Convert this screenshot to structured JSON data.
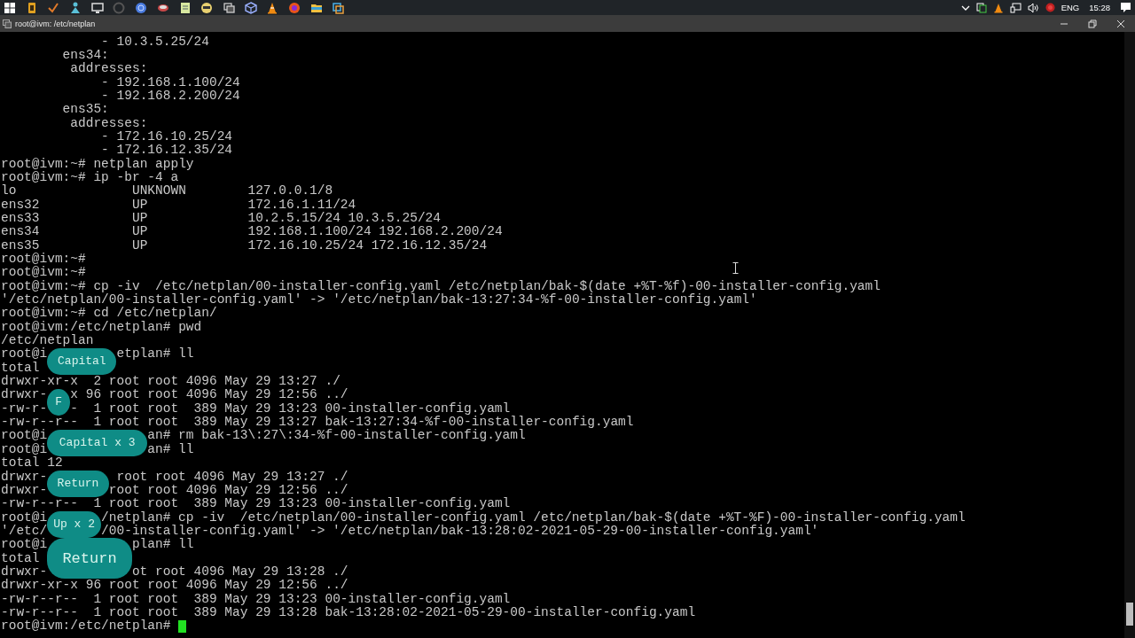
{
  "taskbar": {
    "language": "ENG",
    "clock": "15:28"
  },
  "window": {
    "title": "root@ivm: /etc/netplan"
  },
  "terminal": {
    "lines": [
      "             - 10.3.5.25/24",
      "        ens34:",
      "         addresses:",
      "             - 192.168.1.100/24",
      "             - 192.168.2.200/24",
      "        ens35:",
      "         addresses:",
      "             - 172.16.10.25/24",
      "             - 172.16.12.35/24",
      "root@ivm:~# netplan apply",
      "root@ivm:~# ip -br -4 a",
      "lo               UNKNOWN        127.0.0.1/8",
      "ens32            UP             172.16.1.11/24",
      "ens33            UP             10.2.5.15/24 10.3.5.25/24",
      "ens34            UP             192.168.1.100/24 192.168.2.200/24",
      "ens35            UP             172.16.10.25/24 172.16.12.35/24",
      "root@ivm:~#",
      "root@ivm:~#",
      "root@ivm:~# cp -iv  /etc/netplan/00-installer-config.yaml /etc/netplan/bak-$(date +%T-%f)-00-installer-config.yaml",
      "'/etc/netplan/00-installer-config.yaml' -> '/etc/netplan/bak-13:27:34-%f-00-installer-config.yaml'",
      "root@ivm:~# cd /etc/netplan/",
      "root@ivm:/etc/netplan# pwd",
      "/etc/netplan",
      [
        "root@i",
        "etplan# ll"
      ],
      "total",
      "drwxr-xr-x  2 root root 4096 May 29 13:27 ./",
      [
        "drwxr-",
        "x 96 root root 4096 May 29 12:56 ../"
      ],
      [
        "-rw-r-",
        "-  1 root root  389 May 29 13:23 00-installer-config.yaml"
      ],
      "-rw-r--r--  1 root root  389 May 29 13:27 bak-13:27:34-%f-00-installer-config.yaml",
      [
        "root@i",
        "an# rm bak-13\\:27\\:34-%f-00-installer-config.yaml"
      ],
      [
        "root@i",
        "an# ll"
      ],
      "total 12",
      [
        "drwxr-",
        " root root 4096 May 29 13:27 ./"
      ],
      [
        "drwxr-",
        "root root 4096 May 29 12:56 ../"
      ],
      "-rw-r--r--  1 root root  389 May 29 13:23 00-installer-config.yaml",
      [
        "root@i",
        "/netplan# cp -iv  /etc/netplan/00-installer-config.yaml /etc/netplan/bak-$(date +%T-%F)-00-installer-config.yaml"
      ],
      [
        "'/etc/",
        "/00-installer-config.yaml' -> '/etc/netplan/bak-13:28:02-2021-05-29-00-installer-config.yaml'"
      ],
      [
        "root@i",
        "plan# ll"
      ],
      "total",
      [
        "drwxr-",
        "ot root 4096 May 29 13:28 ./"
      ],
      "drwxr-xr-x 96 root root 4096 May 29 12:56 ../",
      "-rw-r--r--  1 root root  389 May 29 13:23 00-installer-config.yaml",
      "-rw-r--r--  1 root root  389 May 29 13:28 bak-13:28:02-2021-05-29-00-installer-config.yaml",
      "root@ivm:/etc/netplan# "
    ]
  },
  "key_overlays": [
    {
      "label": "Capital",
      "kind": "small"
    },
    {
      "label": "F",
      "kind": "small"
    },
    {
      "label": "Capital x 3",
      "kind": "small"
    },
    {
      "label": "Return",
      "kind": "small"
    },
    {
      "label": "Up x 2",
      "kind": "small"
    },
    {
      "label": "Return",
      "kind": "large"
    }
  ]
}
